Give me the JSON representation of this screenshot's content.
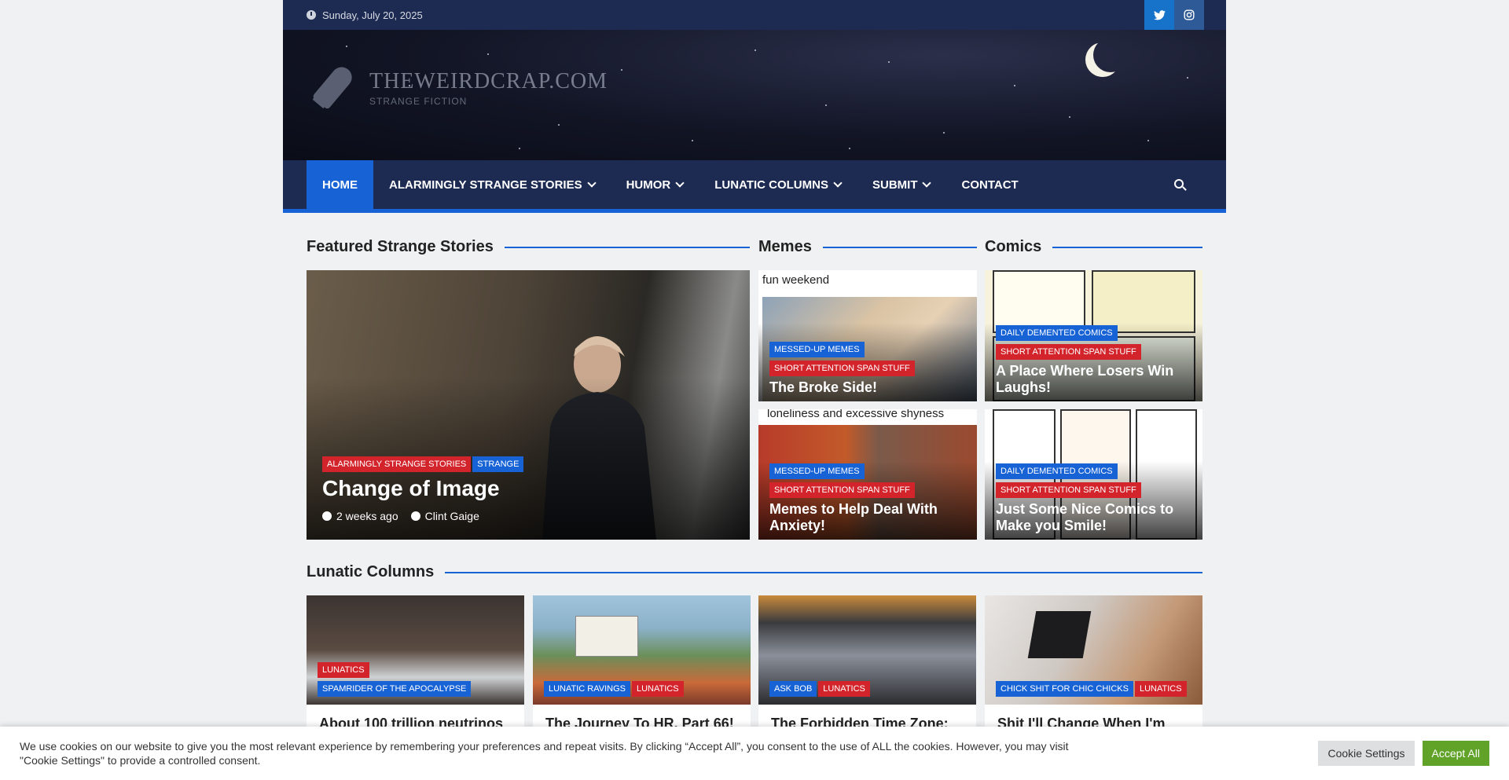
{
  "topbar": {
    "date": "Sunday, July 20, 2025",
    "social": [
      "twitter-icon",
      "instagram-icon"
    ]
  },
  "header": {
    "site_title": "THEWEIRDCRAP.COM",
    "tagline": "STRANGE FICTION"
  },
  "nav": {
    "items": [
      {
        "label": "HOME",
        "active": true,
        "has_dropdown": false
      },
      {
        "label": "ALARMINGLY STRANGE STORIES",
        "active": false,
        "has_dropdown": true
      },
      {
        "label": "HUMOR",
        "active": false,
        "has_dropdown": true
      },
      {
        "label": "LUNATIC COLUMNS",
        "active": false,
        "has_dropdown": true
      },
      {
        "label": "SUBMIT",
        "active": false,
        "has_dropdown": true
      },
      {
        "label": "CONTACT",
        "active": false,
        "has_dropdown": false
      }
    ]
  },
  "featured": {
    "section_title": "Featured Strange Stories",
    "tags": [
      "ALARMINGLY STRANGE STORIES",
      "STRANGE"
    ],
    "title": "Change of Image",
    "time": "2 weeks ago",
    "author": "Clint Gaige"
  },
  "memes": {
    "section_title": "Memes",
    "items": [
      {
        "caption": "fun weekend",
        "tags": [
          "MESSED-UP MEMES",
          "SHORT ATTENTION SPAN STUFF"
        ],
        "title": "The Broke Side!"
      },
      {
        "caption": "loneliness and excessive shyness",
        "tags": [
          "MESSED-UP MEMES",
          "SHORT ATTENTION SPAN STUFF"
        ],
        "title": "Memes to Help Deal With Anxiety!"
      }
    ]
  },
  "comics": {
    "section_title": "Comics",
    "items": [
      {
        "tags": [
          "DAILY DEMENTED COMICS",
          "SHORT ATTENTION SPAN STUFF"
        ],
        "title": "A Place Where Losers Win Laughs!"
      },
      {
        "tags": [
          "DAILY DEMENTED COMICS",
          "SHORT ATTENTION SPAN STUFF"
        ],
        "title": "Just Some Nice Comics to Make you Smile!"
      }
    ]
  },
  "lunatic": {
    "section_title": "Lunatic Columns",
    "items": [
      {
        "tags": [
          "LUNATICS",
          "SPAMRIDER OF THE APOCALYPSE"
        ],
        "title": "About 100 trillion neutrinos"
      },
      {
        "tags": [
          "LUNATIC RAVINGS",
          "LUNATICS"
        ],
        "title": "The Journey To HR, Part 66!"
      },
      {
        "tags": [
          "ASK BOB",
          "LUNATICS"
        ],
        "title": "The Forbidden Time Zone:"
      },
      {
        "tags": [
          "CHICK SHIT FOR CHIC CHICKS",
          "LUNATICS"
        ],
        "title": "Shit I'll Change When I'm"
      }
    ]
  },
  "cookie": {
    "text": "We use cookies on our website to give you the most relevant experience by remembering your preferences and repeat visits. By clicking “Accept All”, you consent to the use of ALL the cookies. However, you may visit \"Cookie Settings\" to provide a controlled consent.",
    "settings_label": "Cookie Settings",
    "accept_label": "Accept All"
  },
  "colors": {
    "navy": "#1d2b52",
    "accent_blue": "#1763d6",
    "tag_red": "#d3242c",
    "accept_green": "#61a229"
  }
}
